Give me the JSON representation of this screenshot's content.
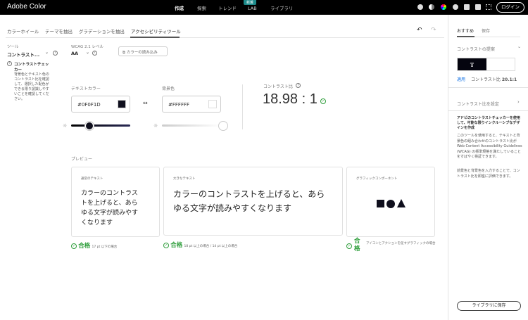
{
  "app": {
    "title": "Adobe Color",
    "nav": [
      "作成",
      "探索",
      "トレンド",
      "LAB",
      "ライブラリ"
    ],
    "new_badge": "新着",
    "login": "ログイン"
  },
  "tabs": [
    "カラーホイール",
    "テーマを抽出",
    "グラデーションを抽出",
    "アクセシビリティツール"
  ],
  "tool": {
    "label": "ツール",
    "value": "コントラスト...",
    "checker_title": "コントラストチェッカー",
    "checker_desc": "背景色とテキスト色のコントラスト比を確認して、選択した配色ができる限り認識しやすいことを確認してください。"
  },
  "wcag": {
    "label": "WCAG 2.1 レベル",
    "value": "AA"
  },
  "import_button": "カラーの読み込み",
  "text_color": {
    "label": "テキストカラー",
    "value": "#0F0F1D",
    "swatch": "#0F0F1D"
  },
  "bg_color": {
    "label": "背景色",
    "value": "#FFFFFF",
    "swatch": "#FFFFFF"
  },
  "contrast": {
    "label": "コントラスト比",
    "value": "18.98 : 1"
  },
  "preview": {
    "label": "プレビュー",
    "cards": [
      {
        "title": "通常のテキスト",
        "sample": "カラーのコントラストを上げると、あらゆる文字が読みやすくなります",
        "result": "合格",
        "note": "17 pt 以下の場合"
      },
      {
        "title": "大きなテキスト",
        "sample": "カラーのコントラストを上げると、あらゆる文字が読みやすくなります",
        "result": "合格",
        "note": "18 pt 以上の場合 / 14 pt 以上の場合"
      },
      {
        "title": "グラフィックコンポーネント",
        "result": "合格",
        "note": "アイコンとアクションを促すグラフィックの場合"
      }
    ]
  },
  "right": {
    "tabs": [
      "おすすめ",
      "保存"
    ],
    "suggest_label": "コントラストの提案",
    "sample_letter": "T",
    "apply": "適用",
    "ratio_label": "コントラスト比",
    "ratio_value": "20.1:1",
    "set_ratio": "コントラスト比を設定",
    "promo_title": "アドビのコントラストチェッカーを使用して、可能な限りインクルーシブなデザインを作成",
    "promo_p1": "このツールを使用すると、テキストと背景色の組み合わせのコントラスト比が Web Content Accessibility Guidelines (WCAG) の標準規格を満たしていることをすばやく検証できます。",
    "promo_p2": "前景色と背景色を入力することで、コントラスト比を即座に評価できます。",
    "save_button": "ライブラリに保存"
  }
}
